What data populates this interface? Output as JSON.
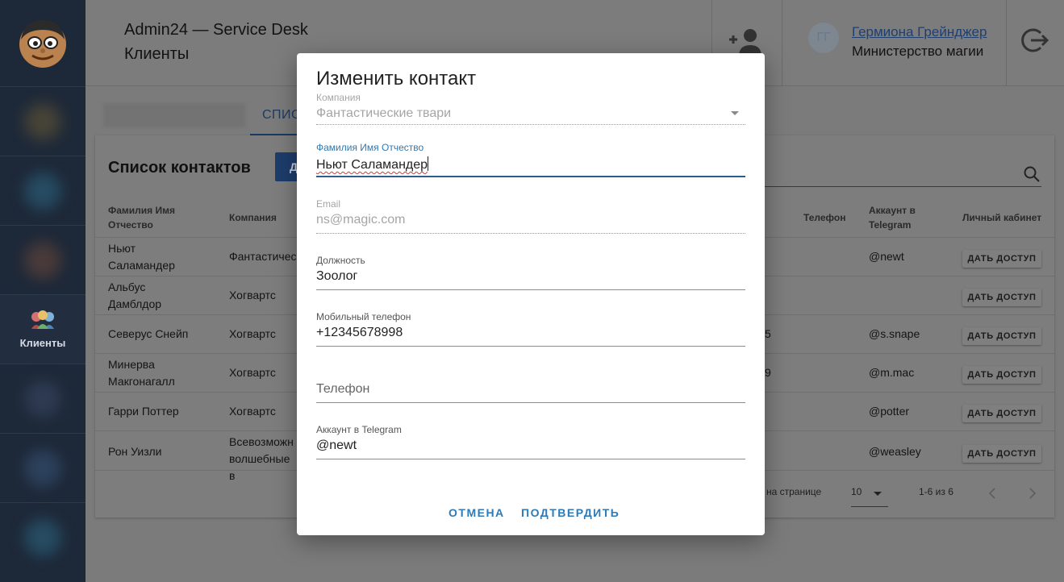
{
  "sidebar": {
    "active_label": "Клиенты",
    "colors": {
      "bg": "#1d2838",
      "active_bg": "#222e40"
    }
  },
  "header": {
    "app_title": "Admin24 — Service Desk",
    "page_title": "Клиенты",
    "user": {
      "initials": "ГГ",
      "name": "Гермиона Грейнджер",
      "organization": "Министерство магии"
    }
  },
  "tabs": {
    "active": "СПИСОК"
  },
  "card": {
    "title": "Список контактов",
    "add_button_label": "Д",
    "columns": {
      "name": "Фамилия Имя Отчество",
      "company": "Компания",
      "phone": "Телефон",
      "telegram": "Аккаунт в Telegram",
      "cabinet": "Личный кабинет"
    },
    "rows": [
      {
        "name": "Ньют Саламандер",
        "company": "Фантастичес",
        "mobile_suffix": "",
        "telegram": "@newt",
        "action": "ДАТЬ ДОСТУП"
      },
      {
        "name": "Альбус Дамблдор",
        "company": "Хогвартс",
        "mobile_suffix": "",
        "telegram": "",
        "action": "ДАТЬ ДОСТУП"
      },
      {
        "name": "Северус Снейп",
        "company": "Хогвартс",
        "mobile_suffix": "5",
        "telegram": "@s.snape",
        "action": "ДАТЬ ДОСТУП"
      },
      {
        "name": "Минерва Макгонагалл",
        "company": "Хогвартс",
        "mobile_suffix": "9",
        "telegram": "@m.mac",
        "action": "ДАТЬ ДОСТУП"
      },
      {
        "name": "Гарри Поттер",
        "company": "Хогвартс",
        "mobile_suffix": "",
        "telegram": "@potter",
        "action": "ДАТЬ ДОСТУП"
      },
      {
        "name": "Рон Уизли",
        "company": "Всевозможн волшебные в",
        "mobile_suffix": "",
        "telegram": "@weasley",
        "action": "ДАТЬ ДОСТУП"
      }
    ],
    "pagination": {
      "per_page_label": "на странице",
      "per_page": "10",
      "range": "1-6 из 6"
    }
  },
  "modal": {
    "title": "Изменить контакт",
    "fields": {
      "company": {
        "label": "Компания",
        "value": "Фантастические твари"
      },
      "full_name": {
        "label": "Фамилия Имя Отчество",
        "value": "Ньют Саламандер"
      },
      "email": {
        "label": "Email",
        "value": "ns@magic.com"
      },
      "position": {
        "label": "Должность",
        "value": "Зоолог"
      },
      "mobile": {
        "label": "Мобильный телефон",
        "value": "+12345678998"
      },
      "phone": {
        "placeholder": "Телефон"
      },
      "telegram": {
        "label": "Аккаунт в Telegram",
        "value": "@newt"
      }
    },
    "cancel_label": "ОТМЕНА",
    "confirm_label": "ПОДТВЕРДИТЬ",
    "accent_color": "#2c7ab8"
  }
}
